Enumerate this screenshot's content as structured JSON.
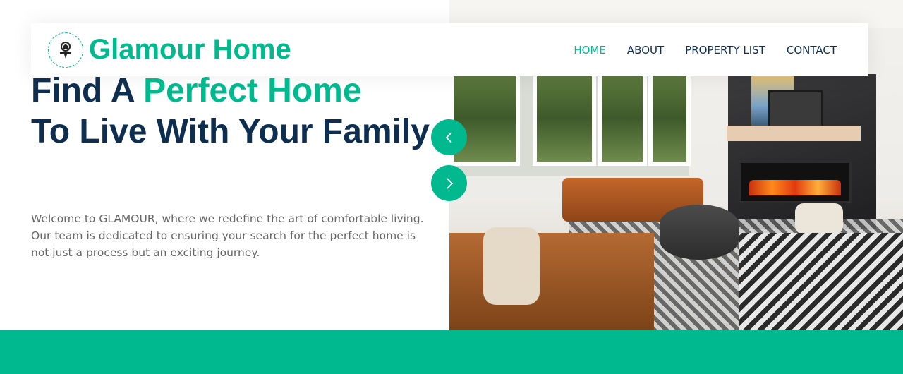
{
  "brand": {
    "name": "Glamour Home",
    "logo_icon": "house-logo-icon",
    "accent_color": "#00b98e",
    "dark_color": "#0e2e50"
  },
  "nav": {
    "items": [
      {
        "label": "HOME",
        "active": true
      },
      {
        "label": "ABOUT",
        "active": false
      },
      {
        "label": "PROPERTY LIST",
        "active": false
      },
      {
        "label": "CONTACT",
        "active": false
      }
    ]
  },
  "hero": {
    "title_part1": "Find A ",
    "title_accent": "Perfect Home",
    "title_part2": "To Live With Your Family",
    "description": "Welcome to GLAMOUR, where we redefine the art of comfortable living. Our team is dedicated to ensuring your search for the perfect home is not just a process but an exciting journey."
  },
  "carousel": {
    "prev_icon": "chevron-left-icon",
    "next_icon": "chevron-right-icon"
  }
}
